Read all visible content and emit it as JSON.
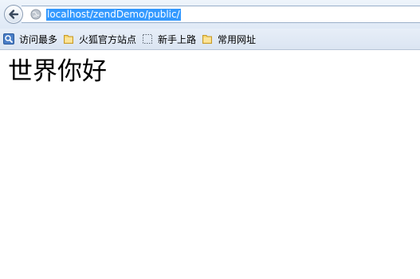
{
  "browser": {
    "address_bar": {
      "url": "localhost/zendDemo/public/"
    },
    "bookmarks": [
      {
        "label": "访问最多",
        "icon": "most-visited-icon"
      },
      {
        "label": "火狐官方站点",
        "icon": "folder-icon"
      },
      {
        "label": "新手上路",
        "icon": "dotted-page-icon"
      },
      {
        "label": "常用网址",
        "icon": "folder-icon"
      }
    ]
  },
  "page": {
    "heading": "世界你好"
  },
  "colors": {
    "selection": "#3399ff",
    "toolbar": "#dfe9f6",
    "folder": "#f5d46a"
  }
}
